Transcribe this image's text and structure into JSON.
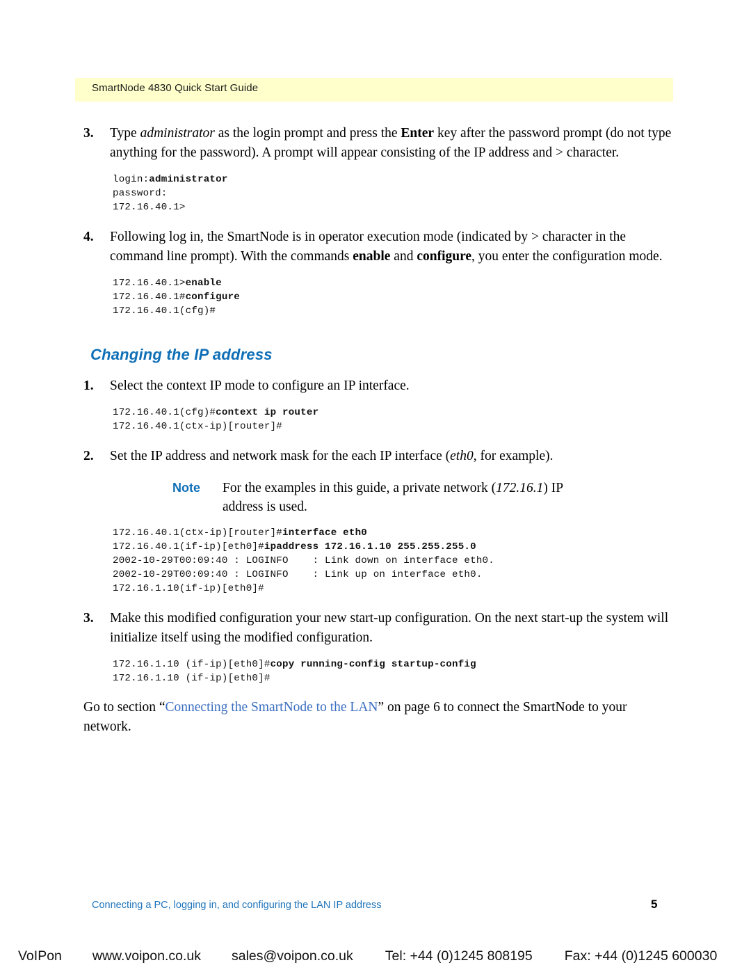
{
  "header": {
    "running_title": "SmartNode 4830 Quick Start Guide",
    "band_color": "#ffffcc"
  },
  "colors": {
    "heading_blue": "#0f6fb6",
    "xref_blue": "#3c6fc0",
    "footer_blue": "#1f74bb"
  },
  "steps": [
    {
      "number": "3.",
      "text_parts": {
        "p1": "Type ",
        "em1": "administrator",
        "p2": " as the login prompt and press the ",
        "b1": "Enter",
        "p3": " key after the password prompt (do not type anything for the password). A prompt will appear consisting of the IP address and > character."
      },
      "cli": {
        "line1_plain": "login:",
        "line1_bold": "administrator",
        "line2": "password:",
        "line3": "172.16.40.1>"
      }
    },
    {
      "number": "4.",
      "text_parts": {
        "p1": "Following log in, the SmartNode is in operator execution mode (indicated by > character in the command line prompt). With the commands ",
        "b1": "enable",
        "p2": " and ",
        "b2": "configure",
        "p3": ", you enter the configuration mode."
      },
      "cli": {
        "line1_plain": "172.16.40.1>",
        "line1_bold": "enable",
        "line2_plain": "172.16.40.1#",
        "line2_bold": "configure",
        "line3": "172.16.40.1(cfg)#"
      }
    }
  ],
  "section": {
    "heading": "Changing the IP address",
    "steps": [
      {
        "number": "1.",
        "text": "Select the context IP mode to configure an IP interface.",
        "cli": {
          "line1_plain": "172.16.40.1(cfg)#",
          "line1_bold": "context ip router",
          "line2": "172.16.40.1(ctx-ip)[router]#"
        }
      },
      {
        "number": "2.",
        "text_parts": {
          "p1": "Set the IP address and network mask for the each IP interface (",
          "em1": "eth0",
          "p2": ", for example)."
        },
        "note": {
          "label": "Note",
          "p1": "For the examples in this guide, a private network (",
          "em1": "172.16.1",
          "p2": ") IP address is used."
        },
        "cli": {
          "line1_plain": "172.16.40.1(ctx-ip)[router]#",
          "line1_bold": "interface eth0",
          "line2_plain": "172.16.40.1(if-ip)[eth0]#",
          "line2_bold": "ipaddress 172.16.1.10 255.255.255.0",
          "line3": "2002-10-29T00:09:40 : LOGINFO    : Link down on interface eth0.",
          "line4": "2002-10-29T00:09:40 : LOGINFO    : Link up on interface eth0.",
          "line5": "172.16.1.10(if-ip)[eth0]#"
        }
      },
      {
        "number": "3.",
        "text": "Make this modified configuration your new start-up configuration. On the next start-up the system will initialize itself using the modified configuration.",
        "cli": {
          "line1_plain": "172.16.1.10 (if-ip)[eth0]#",
          "line1_bold": "copy running-config startup-config",
          "line2": "172.16.1.10 (if-ip)[eth0]#"
        }
      }
    ],
    "closing": {
      "p1": "Go to section “",
      "xref": "Connecting the SmartNode to the LAN",
      "p2": "” on page 6 to connect the SmartNode to your network."
    }
  },
  "footer": {
    "text": "Connecting a PC, logging in, and configuring the LAN IP address",
    "page_number": "5"
  },
  "banner": {
    "brand": "VoIPon",
    "website": "www.voipon.co.uk",
    "email": "sales@voipon.co.uk",
    "tel": "Tel: +44 (0)1245 808195",
    "fax": "Fax: +44 (0)1245 600030"
  }
}
